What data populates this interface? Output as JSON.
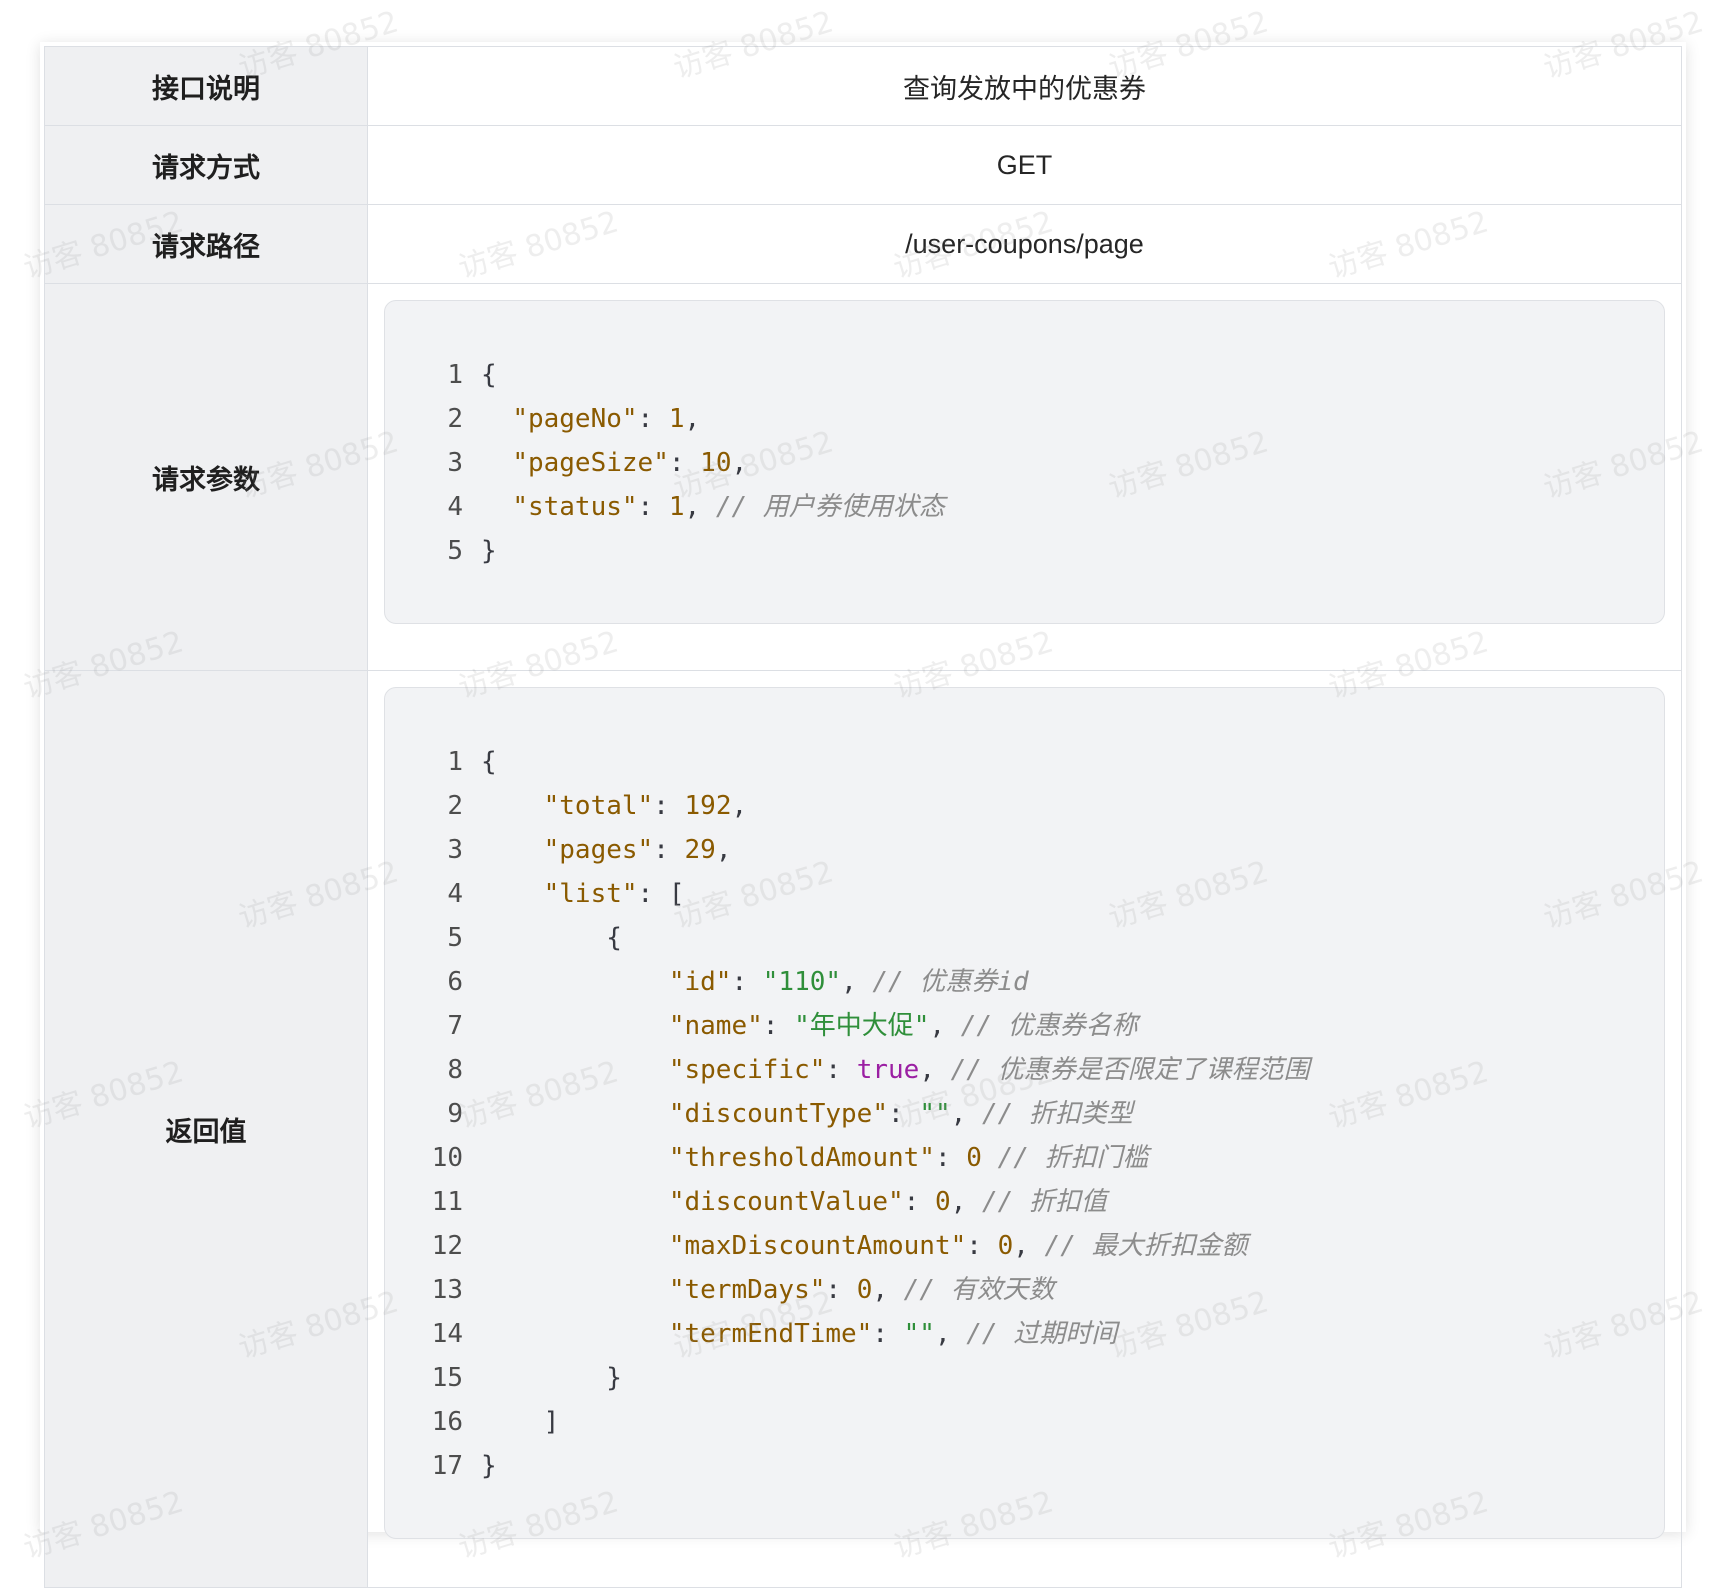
{
  "table": {
    "rows": [
      {
        "key": "接口说明",
        "value": "查询发放中的优惠券"
      },
      {
        "key": "请求方式",
        "value": "GET"
      },
      {
        "key": "请求路径",
        "value": "/user-coupons/page"
      },
      {
        "key": "请求参数"
      },
      {
        "key": "返回值"
      }
    ]
  },
  "request_code": {
    "line_numbers": [
      "1",
      "2",
      "3",
      "4",
      "5"
    ],
    "lines": [
      {
        "text": "{"
      },
      {
        "key": "\"pageNo\"",
        "sep": ": ",
        "num": "1",
        "end": ","
      },
      {
        "key": "\"pageSize\"",
        "sep": ": ",
        "num": "10",
        "end": ","
      },
      {
        "key": "\"status\"",
        "sep": ": ",
        "num": "1",
        "end": ", ",
        "comment": "// 用户券使用状态"
      },
      {
        "text": "}"
      }
    ]
  },
  "response_code": {
    "line_numbers": [
      "1",
      "2",
      "3",
      "4",
      "5",
      "6",
      "7",
      "8",
      "9",
      "10",
      "11",
      "12",
      "13",
      "14",
      "15",
      "16",
      "17"
    ],
    "lines": [
      {
        "text": "{"
      },
      {
        "key": "\"total\"",
        "sep": ": ",
        "num": "192",
        "end": ","
      },
      {
        "key": "\"pages\"",
        "sep": ": ",
        "num": "29",
        "end": ","
      },
      {
        "key": "\"list\"",
        "sep": ": ",
        "end": "["
      },
      {
        "text": "{"
      },
      {
        "key": "\"id\"",
        "sep": ": ",
        "str": "\"110\"",
        "end": ", ",
        "comment": "// 优惠券id"
      },
      {
        "key": "\"name\"",
        "sep": ": ",
        "str": "\"年中大促\"",
        "end": ", ",
        "comment": "// 优惠券名称"
      },
      {
        "key": "\"specific\"",
        "sep": ": ",
        "bool": "true",
        "end": ", ",
        "comment": "// 优惠券是否限定了课程范围"
      },
      {
        "key": "\"discountType\"",
        "sep": ": ",
        "str": "\"\"",
        "end": ", ",
        "comment": "// 折扣类型"
      },
      {
        "key": "\"thresholdAmount\"",
        "sep": ": ",
        "num": "0",
        "end": " ",
        "comment": "// 折扣门槛"
      },
      {
        "key": "\"discountValue\"",
        "sep": ": ",
        "num": "0",
        "end": ", ",
        "comment": "// 折扣值"
      },
      {
        "key": "\"maxDiscountAmount\"",
        "sep": ": ",
        "num": "0",
        "end": ", ",
        "comment": "// 最大折扣金额"
      },
      {
        "key": "\"termDays\"",
        "sep": ": ",
        "num": "0",
        "end": ", ",
        "comment": "// 有效天数"
      },
      {
        "key": "\"termEndTime\"",
        "sep": ": ",
        "str": "\"\"",
        "end": ", ",
        "comment": "// 过期时间"
      },
      {
        "text": "}"
      },
      {
        "text": "]"
      },
      {
        "text": "}"
      }
    ]
  },
  "watermark": {
    "text": "访客 80852"
  }
}
